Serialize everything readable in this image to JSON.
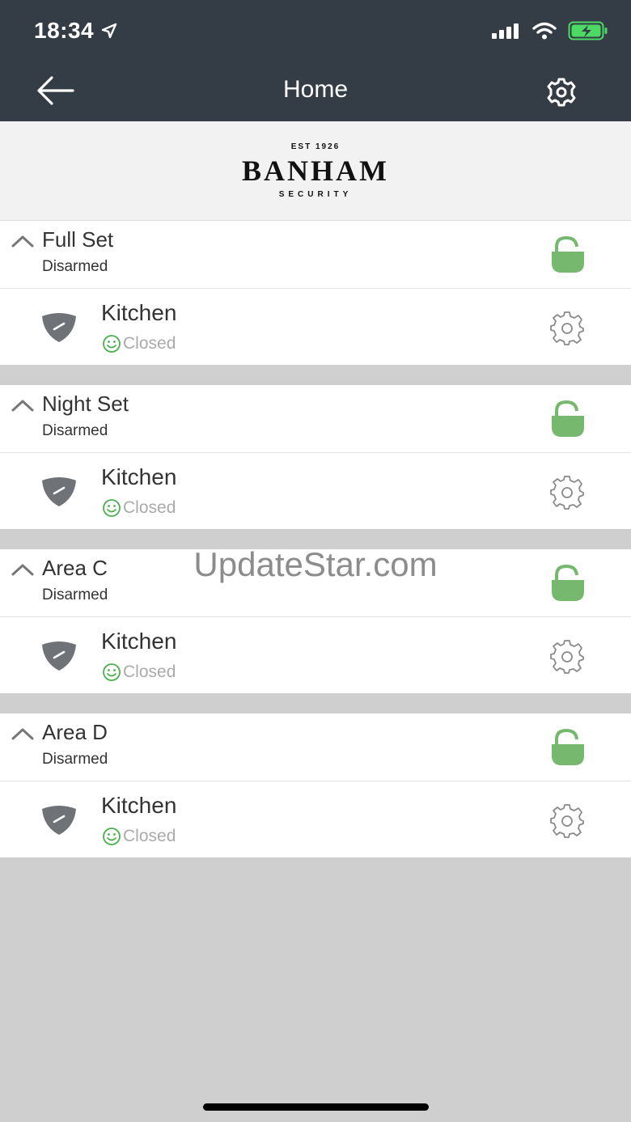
{
  "status_bar": {
    "time": "18:34",
    "icons": [
      "location-arrow-icon",
      "cellular-signal-icon",
      "wifi-icon",
      "battery-charging-icon"
    ],
    "battery_color": "#4cd964"
  },
  "nav": {
    "title": "Home",
    "back_icon": "arrow-left-icon",
    "settings_icon": "gear-icon",
    "background": "#343c46"
  },
  "brand": {
    "est": "EST 1926",
    "name": "BANHAM",
    "sub": "SECURITY"
  },
  "colors": {
    "lock_open": "#76b96e",
    "status_ok": "#4caf50",
    "shield": "#6f7378",
    "page_bg": "#cfcfcf"
  },
  "areas": [
    {
      "name": "Full Set",
      "status": "Disarmed",
      "lock_icon": "unlocked-padlock-icon",
      "zones": [
        {
          "name": "Kitchen",
          "state": "Closed",
          "icon": "shield-icon",
          "state_icon": "smiley-icon",
          "settings_icon": "gear-icon"
        }
      ]
    },
    {
      "name": "Night Set",
      "status": "Disarmed",
      "lock_icon": "unlocked-padlock-icon",
      "zones": [
        {
          "name": "Kitchen",
          "state": "Closed",
          "icon": "shield-icon",
          "state_icon": "smiley-icon",
          "settings_icon": "gear-icon"
        }
      ]
    },
    {
      "name": "Area C",
      "status": "Disarmed",
      "lock_icon": "unlocked-padlock-icon",
      "zones": [
        {
          "name": "Kitchen",
          "state": "Closed",
          "icon": "shield-icon",
          "state_icon": "smiley-icon",
          "settings_icon": "gear-icon"
        }
      ]
    },
    {
      "name": "Area D",
      "status": "Disarmed",
      "lock_icon": "unlocked-padlock-icon",
      "zones": [
        {
          "name": "Kitchen",
          "state": "Closed",
          "icon": "shield-icon",
          "state_icon": "smiley-icon",
          "settings_icon": "gear-icon"
        }
      ]
    }
  ],
  "watermark": "UpdateStar.com"
}
